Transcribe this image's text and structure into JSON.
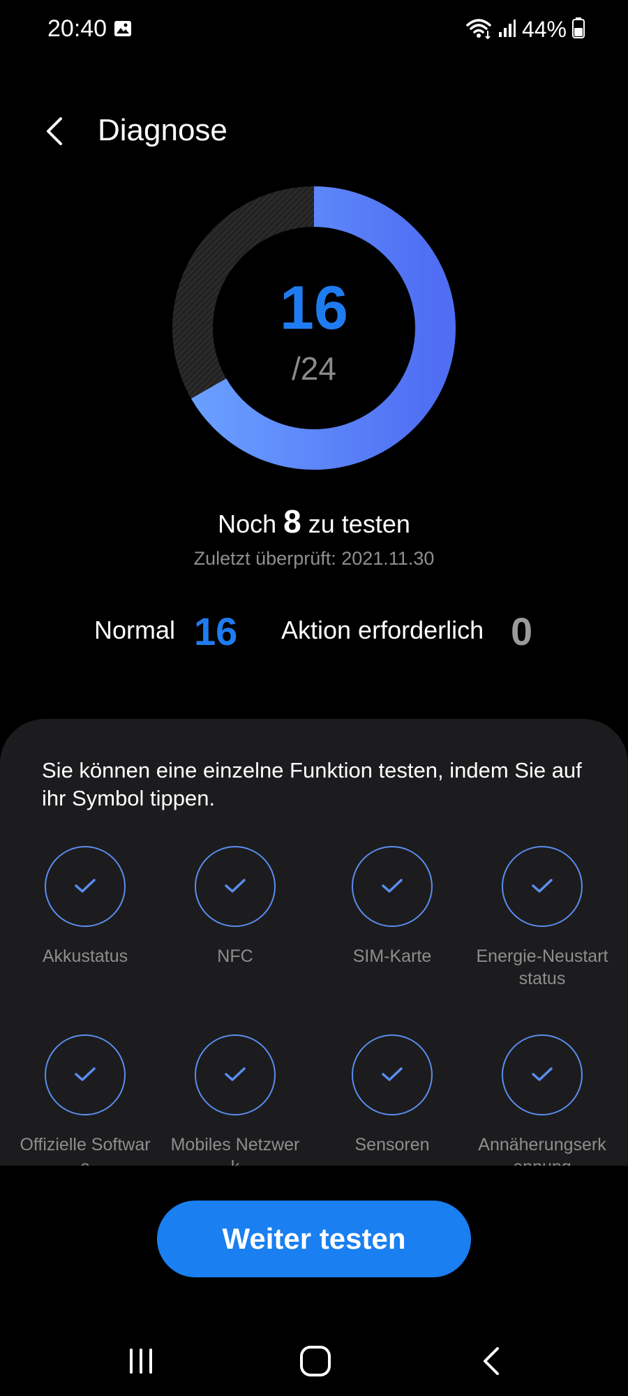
{
  "status_bar": {
    "time": "20:40",
    "battery_percent": "44%",
    "icons": [
      "image-icon",
      "wifi-icon",
      "signal-icon",
      "battery-icon"
    ]
  },
  "header": {
    "title": "Diagnose",
    "back_icon": "chevron-left-icon"
  },
  "progress": {
    "tested": "16",
    "total": "/24",
    "fraction_complete": 0.6667,
    "ring_color_start": "#6aa0ff",
    "ring_color_end": "#4f6ef3",
    "ring_track_color": "#2a2a2a"
  },
  "remaining": {
    "prefix": "Noch",
    "count": "8",
    "suffix": "zu testen"
  },
  "last_checked": "Zuletzt überprüft: 2021.11.30",
  "summary": {
    "normal_label": "Normal",
    "normal_value": "16",
    "action_label": "Aktion erforderlich",
    "action_value": "0"
  },
  "panel": {
    "hint": "Sie können eine einzelne Funktion testen, indem Sie auf ihr Symbol tippen.",
    "tests": [
      {
        "label": "Akkustatus",
        "icon": "check-icon"
      },
      {
        "label": "NFC",
        "icon": "check-icon"
      },
      {
        "label": "SIM-Karte",
        "icon": "check-icon"
      },
      {
        "label": "Energie-Neustartstatus",
        "icon": "check-icon"
      },
      {
        "label": "Offizielle Software",
        "icon": "check-icon"
      },
      {
        "label": "Mobiles Netzwerk",
        "icon": "check-icon"
      },
      {
        "label": "Sensoren",
        "icon": "check-icon"
      },
      {
        "label": "Annäherungserkennung",
        "icon": "check-icon"
      }
    ]
  },
  "primary_button": {
    "label": "Weiter testen"
  },
  "nav_bar": {
    "icons": [
      "recent-apps-icon",
      "home-icon",
      "back-icon"
    ]
  },
  "colors": {
    "accent": "#1a7ff0",
    "success_outline": "#5b8def",
    "panel_bg": "#1c1c1e"
  }
}
